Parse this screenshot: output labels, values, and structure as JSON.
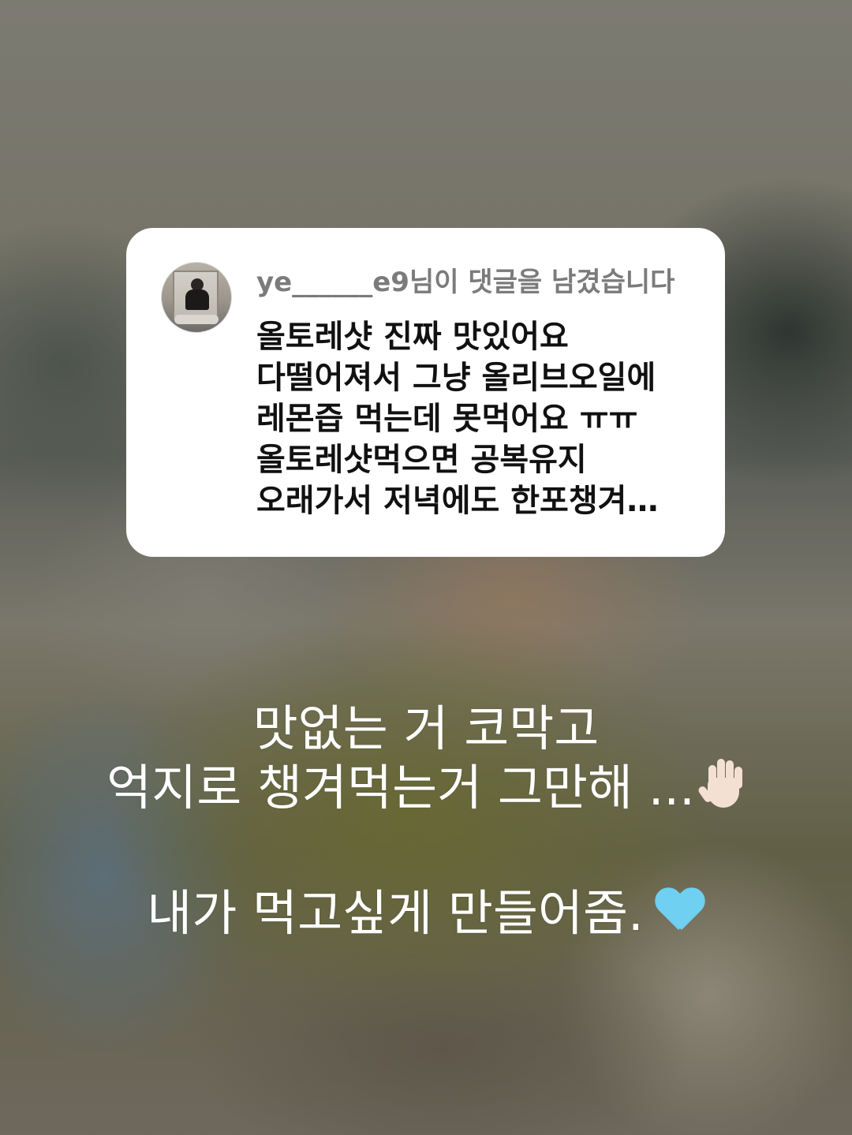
{
  "comment_card": {
    "avatar_icon": "user-avatar-photo",
    "header": "ye______e9님이 댓글을 남겼습니다",
    "comment_lines": [
      "올토레샷 진짜 맛있어요",
      "다떨어져서 그냥 올리브오일에",
      "레몬즙 먹는데 못먹어요 ㅠㅠ",
      "올토레샷먹으면 공복유지",
      "오래가서 저녁에도 한포챙겨…"
    ]
  },
  "reply": {
    "line1": "맛없는 거 코막고",
    "line2": "억지로 챙겨먹는거 그만해 ...",
    "line2_icon": "raised-hand-emoji",
    "line3": "내가 먹고싶게 만들어줌.",
    "line3_icon": "light-blue-heart-emoji"
  },
  "colors": {
    "card_background": "#ffffff",
    "header_text": "#7b7b7b",
    "comment_text": "#111111",
    "caption_text": "#ffffff",
    "heart": "#6fd0f2"
  }
}
